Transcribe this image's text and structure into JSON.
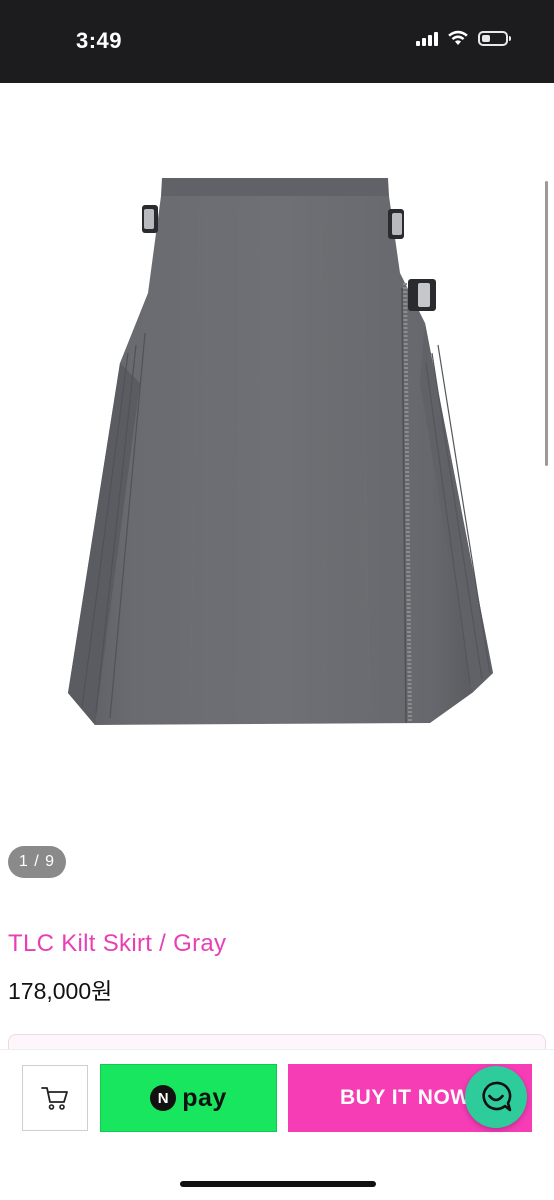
{
  "status_bar": {
    "time": "3:49",
    "icons": [
      "cellular-signal-icon",
      "wifi-icon",
      "battery-icon"
    ],
    "battery_level": 0.25
  },
  "gallery": {
    "image_subject": "gray pleated kilt skirt with buckle straps",
    "counter": "1 / 9",
    "current_index": 1,
    "total_images": 9
  },
  "product": {
    "title": "TLC Kilt Skirt / Gray",
    "price": "178,000원"
  },
  "actions": {
    "cart_icon": "cart-icon",
    "npay_logo": "N",
    "npay_label": "pay",
    "buy_label": "BUY IT NOW",
    "chat_icon": "chat-icon"
  },
  "colors": {
    "title": "#e83fb5",
    "buy_button": "#f63db6",
    "npay_button": "#19e65f",
    "chat_button": "#2ecc9a",
    "status_bar": "#1c1c1e"
  }
}
